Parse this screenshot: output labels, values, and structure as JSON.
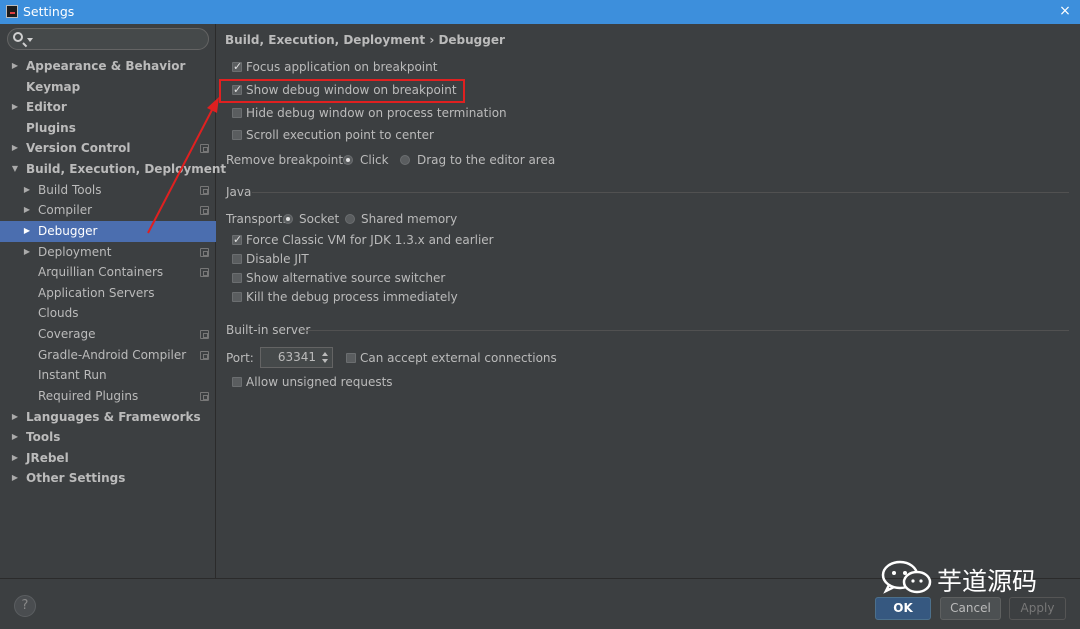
{
  "window": {
    "title": "Settings",
    "close_glyph": "×"
  },
  "search": {
    "placeholder": ""
  },
  "sidebar": {
    "items": [
      {
        "label": "Appearance & Behavior"
      },
      {
        "label": "Keymap"
      },
      {
        "label": "Editor"
      },
      {
        "label": "Plugins"
      },
      {
        "label": "Version Control"
      },
      {
        "label": "Build, Execution, Deployment"
      },
      {
        "label": "Build Tools"
      },
      {
        "label": "Compiler"
      },
      {
        "label": "Debugger"
      },
      {
        "label": "Deployment"
      },
      {
        "label": "Arquillian Containers"
      },
      {
        "label": "Application Servers"
      },
      {
        "label": "Clouds"
      },
      {
        "label": "Coverage"
      },
      {
        "label": "Gradle-Android Compiler"
      },
      {
        "label": "Instant Run"
      },
      {
        "label": "Required Plugins"
      },
      {
        "label": "Languages & Frameworks"
      },
      {
        "label": "Tools"
      },
      {
        "label": "JRebel"
      },
      {
        "label": "Other Settings"
      }
    ],
    "selected": "Debugger"
  },
  "breadcrumb": "Build, Execution, Deployment › Debugger",
  "debugger": {
    "focus_app": {
      "label": "Focus application on breakpoint",
      "checked": true
    },
    "show_debug": {
      "label": "Show debug window on breakpoint",
      "checked": true
    },
    "hide_debug": {
      "label": "Hide debug window on process termination",
      "checked": false
    },
    "scroll_exec": {
      "label": "Scroll execution point to center",
      "checked": false
    },
    "remove_bp_label": "Remove breakpoint:",
    "remove_bp_options": [
      "Click",
      "Drag to the editor area"
    ],
    "remove_bp_selected": "Click"
  },
  "java": {
    "section": "Java",
    "transport_label": "Transport:",
    "transport_options": [
      "Socket",
      "Shared memory"
    ],
    "transport_selected": "Socket",
    "force_classic": {
      "label": "Force Classic VM for JDK 1.3.x and earlier",
      "checked": true
    },
    "disable_jit": {
      "label": "Disable JIT",
      "checked": false
    },
    "alt_source": {
      "label": "Show alternative source switcher",
      "checked": false
    },
    "kill_process": {
      "label": "Kill the debug process immediately",
      "checked": false
    }
  },
  "builtin": {
    "section": "Built-in server",
    "port_label": "Port:",
    "port_value": "63341",
    "external": {
      "label": "Can accept external connections",
      "checked": false
    },
    "unsigned": {
      "label": "Allow unsigned requests",
      "checked": false
    }
  },
  "footer": {
    "help": "?",
    "ok": "OK",
    "cancel": "Cancel",
    "apply": "Apply"
  },
  "watermark": {
    "text": "芋道源码"
  },
  "colors": {
    "accent": "#4b6eaf",
    "titlebar": "#3d8fdc",
    "highlight_box": "#e02020"
  }
}
